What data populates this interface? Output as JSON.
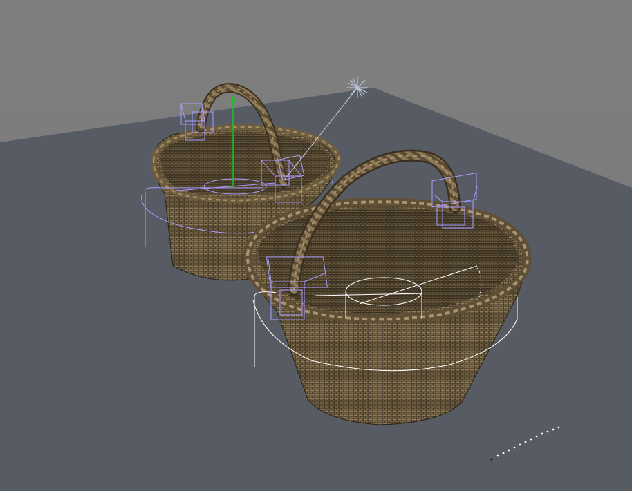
{
  "viewport": {
    "label": "",
    "colors": {
      "sky": "#7e7e7e",
      "ground": "#575c64",
      "wicker_dark": "#3e3322",
      "wicker_mid": "#6b5a3f",
      "wicker_light": "#9a8663",
      "selection_wire": "#a99cff",
      "helper_white": "#ffffff",
      "gizmo_green": "#1fc21f",
      "light_icon": "#b8c4dc"
    }
  },
  "objects": [
    {
      "name": "wicker-basket-back",
      "icon": "basket"
    },
    {
      "name": "wicker-basket-front",
      "icon": "basket"
    },
    {
      "name": "omni-light",
      "icon": "star-light-icon"
    },
    {
      "name": "move-gizmo",
      "icon": "axis-gizmo-icon"
    }
  ]
}
